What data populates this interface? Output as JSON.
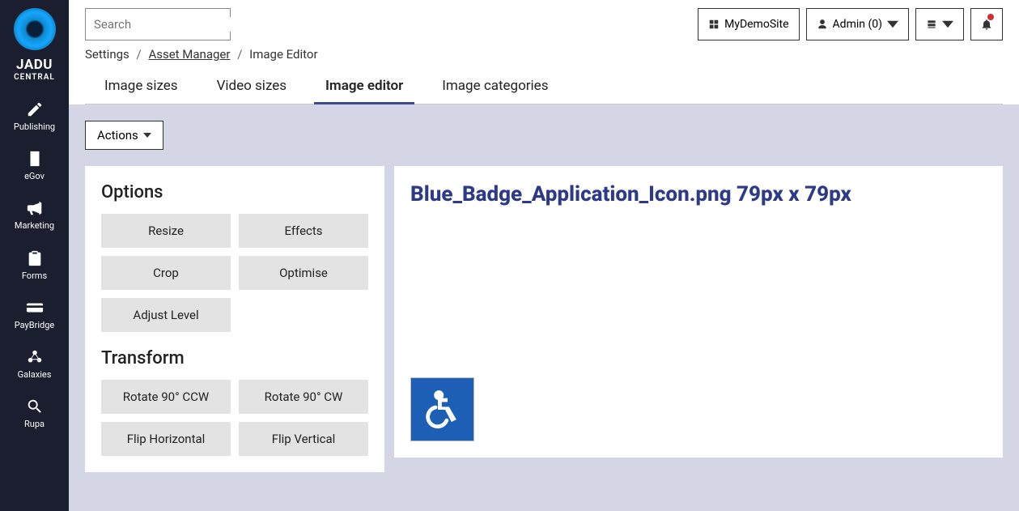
{
  "brand": {
    "main": "JADU",
    "sub": "CENTRAL"
  },
  "nav": [
    {
      "label": "Publishing",
      "icon": "pencil"
    },
    {
      "label": "eGov",
      "icon": "building"
    },
    {
      "label": "Marketing",
      "icon": "bullhorn"
    },
    {
      "label": "Forms",
      "icon": "clipboard"
    },
    {
      "label": "PayBridge",
      "icon": "card"
    },
    {
      "label": "Galaxies",
      "icon": "nodes"
    },
    {
      "label": "Rupa",
      "icon": "search"
    }
  ],
  "search": {
    "placeholder": "Search"
  },
  "topbar": {
    "site": "MyDemoSite",
    "user": "Admin (0)"
  },
  "breadcrumb": {
    "a": "Settings",
    "b": "Asset Manager",
    "c": "Image Editor"
  },
  "tabs": [
    {
      "label": "Image sizes",
      "active": false
    },
    {
      "label": "Video sizes",
      "active": false
    },
    {
      "label": "Image editor",
      "active": true
    },
    {
      "label": "Image categories",
      "active": false
    }
  ],
  "actions_label": "Actions",
  "options": {
    "title": "Options",
    "buttons": [
      "Resize",
      "Effects",
      "Crop",
      "Optimise",
      "Adjust Level"
    ]
  },
  "transform": {
    "title": "Transform",
    "buttons": [
      "Rotate 90° CCW",
      "Rotate 90° CW",
      "Flip Horizontal",
      "Flip Vertical"
    ]
  },
  "image": {
    "title": "Blue_Badge_Application_Icon.png 79px x 79px"
  }
}
